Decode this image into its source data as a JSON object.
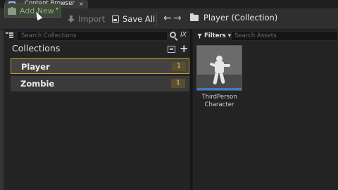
{
  "tab": {
    "label": "Content Browser",
    "close": "×"
  },
  "toolbar": {
    "add_new_label": "Add New",
    "add_new_caret": "▾",
    "import_label": "Import",
    "save_all_label": "Save All",
    "back_arrow": "←",
    "forward_arrow": "→",
    "path": "Player (Collection)"
  },
  "sources": {
    "search_placeholder": "Search Collections",
    "shortcut_icon": "Ⅸ",
    "title": "Collections",
    "add_glyph": "+",
    "items": [
      {
        "label": "Player",
        "count": "1",
        "selected": true
      },
      {
        "label": "Zombie",
        "count": "1",
        "selected": false
      }
    ]
  },
  "assets": {
    "filters_label": "Filters",
    "filters_caret": "▾",
    "search_placeholder": "Search Assets",
    "items": [
      {
        "name_line1": "ThirdPerson",
        "name_line2": "Character"
      }
    ]
  },
  "colors": {
    "selection_border": "#c69b2a",
    "thumb_bar": "#3d78c8",
    "add_new_bg": "#3c4a37"
  }
}
